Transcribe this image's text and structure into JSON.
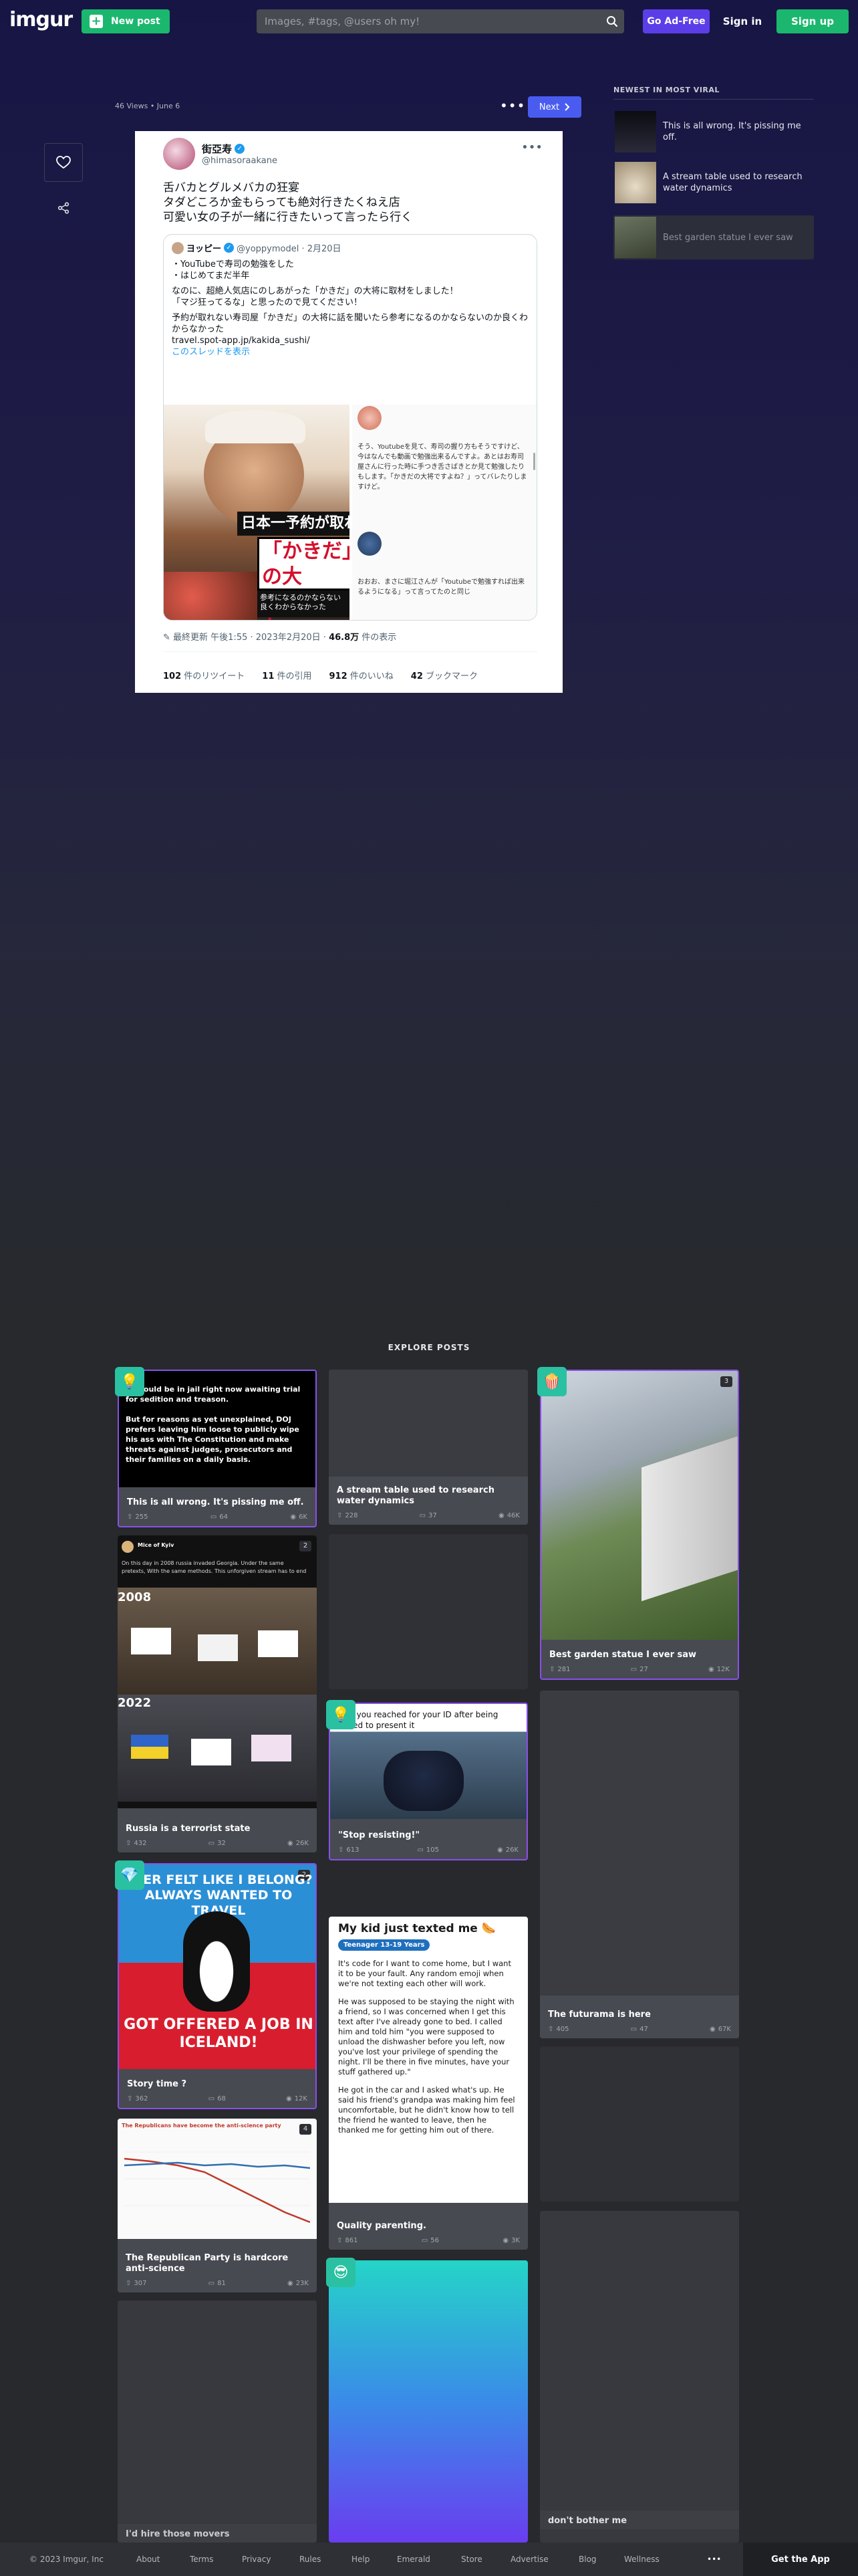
{
  "header": {
    "logo": "imgur",
    "new_post": "New post",
    "search_placeholder": "Images, #tags, @users oh my!",
    "go_ad_free": "Go Ad-Free",
    "sign_in": "Sign in",
    "sign_up": "Sign up"
  },
  "post": {
    "meta": "46 Views • June 6",
    "next": "Next",
    "tweet": {
      "name": "街亞寿",
      "handle": "@himasoraakane",
      "text_lines": [
        "舌バカとグルメバカの狂宴",
        "タダどころか金もらっても絶対行きたくねえ店",
        "可愛い女の子が一緒に行きたいって言ったら行く"
      ],
      "quote_name": "ヨッピー",
      "quote_handle": "@yoppymodel · 2月20日",
      "quote_lines": [
        "・YouTubeで寿司の勉強をした",
        "・はじめてまだ半年",
        "なのに、超絶人気店にのしあがった「かきだ」の大将に取材をしました！",
        "「マジ狂ってるな」と思ったので見てください！",
        "予約が取れない寿司屋「かきだ」の大将に話を聞いたら参考になるのかならないのか良くわからなかった",
        "travel.spot-app.jp/kakida_sushi/"
      ],
      "quote_link": "このスレッドを表示",
      "img_banner1": "日本一予約が取れな",
      "img_banner2": "「かきだ」の大\n話を聞いた",
      "img_banner3": "参考になるのかならない\n良くわからなかった",
      "reply1": "そう、Youtubeを見て、寿司の握り方もそうですけど、今はなんでも動画で勉強出来るんですよ。あとはお寿司屋さんに行った時に手つき舌さばきとか見て勉強したりもします。「かきだの大将ですよね？」ってバレたりしますけど。",
      "reply2": "おおお、まさに堀江さんが「Youtubeで勉強すれば出来るようになる」って言ってたのと同じ",
      "footer_time": "最終更新 午後1:55 · 2023年2月20日 · ",
      "footer_views": "46.8万",
      "footer_views_suffix": " 件の表示",
      "retweets": "102",
      "retweets_label": " 件のリツイート",
      "quotes": "11",
      "quotes_label": " 件の引用",
      "likes": "912",
      "likes_label": " 件のいいね",
      "bookmarks": "42",
      "bookmarks_label": " ブックマーク"
    }
  },
  "sidebar": {
    "title": "NEWEST IN MOST VIRAL",
    "items": [
      {
        "title": "This is all wrong.  It's pissing me off."
      },
      {
        "title": "A stream table used to research water dynamics"
      },
      {
        "title": "Best garden statue I ever saw"
      }
    ]
  },
  "explore": {
    "title": "EXPLORE POSTS",
    "cards": [
      {
        "title": "This is all wrong.  It's pissing me off.",
        "ups": "255",
        "comments": "64",
        "views": "6K",
        "img_text": "...should be in jail right now awaiting trial for sedition and treason.\n\nBut for reasons as yet unexplained, DOJ prefers leaving him loose to publicly wipe his ass with The Constitution and make threats against judges, prosecutors and their families on a daily basis."
      },
      {
        "title": "A stream table used to research water dynamics",
        "ups": "228",
        "comments": "37",
        "views": "46K"
      },
      {
        "title": "Best garden statue I ever saw",
        "ups": "281",
        "comments": "27",
        "views": "12K",
        "count": "3"
      },
      {
        "title": "Russia is a terrorist state",
        "ups": "432",
        "comments": "32",
        "views": "26K",
        "count": "2",
        "tweet_name": "Mice of Kyiv",
        "tweet_text": "On this day in 2008 russia invaded Georgia. Under the same pretexts, With the same methods. This unforgiven stream has to end",
        "year1": "2008",
        "year2": "2022"
      },
      {
        "title": "\"Stop resisting!\"",
        "ups": "613",
        "comments": "105",
        "views": "26K",
        "img_text": "Me: you reached for your ID after being asked to present it"
      },
      {
        "title": "The futurama is here",
        "ups": "405",
        "comments": "47",
        "views": "67K"
      },
      {
        "title": "Story time ?",
        "ups": "362",
        "comments": "68",
        "views": "12K",
        "img_top": "EVER FELT LIKE I BELONG?\nALWAYS WANTED TO TRAVEL",
        "img_bottom": "GOT OFFERED A JOB IN\nICELAND!",
        "count": "2"
      },
      {
        "title": "Quality parenting.",
        "ups": "861",
        "comments": "56",
        "views": "3K",
        "doc_title": "My kid just texted me 🌭",
        "doc_tag": "Teenager 13-19 Years",
        "doc_p1": "It's code for I want to come home, but I want it to be your fault. Any random emoji when we're not texting each other will work.",
        "doc_p2": "He was supposed to be staying the night with a friend, so I was concerned when I get this text after I've already gone to bed. I called him and told him \"you were supposed to unload the dishwasher before you left, now you've lost your privilege of spending the night. I'll be there in five minutes, have your stuff gathered up.\"",
        "doc_p3": "He got in the car and I asked what's up. He said his friend's grandpa was making him feel uncomfortable, but he didn't know how to tell the friend he wanted to leave, then he thanked me for getting him out of there."
      },
      {
        "title": "The Republican Party is hardcore anti-science",
        "ups": "307",
        "comments": "81",
        "views": "23K",
        "count": "4",
        "chart_title": "The Republicans have become the anti-science party"
      },
      {
        "title": "I'd hire those movers",
        "ups": "",
        "comments": "",
        "views": ""
      },
      {
        "title": "don't bother me",
        "ups": "",
        "comments": "",
        "views": ""
      }
    ]
  },
  "footer": {
    "copyright": "© 2023 Imgur, Inc",
    "links": [
      "About",
      "Terms",
      "Privacy",
      "Rules",
      "Help",
      "Emerald",
      "Store",
      "Advertise",
      "Blog",
      "Wellness"
    ],
    "more": "•••",
    "get_app": "Get the App"
  },
  "colors": {
    "green": "#1bb76e",
    "purple": "#5b3ee8",
    "next_blue": "#4a5cf0",
    "card_bg": "#474a51"
  }
}
